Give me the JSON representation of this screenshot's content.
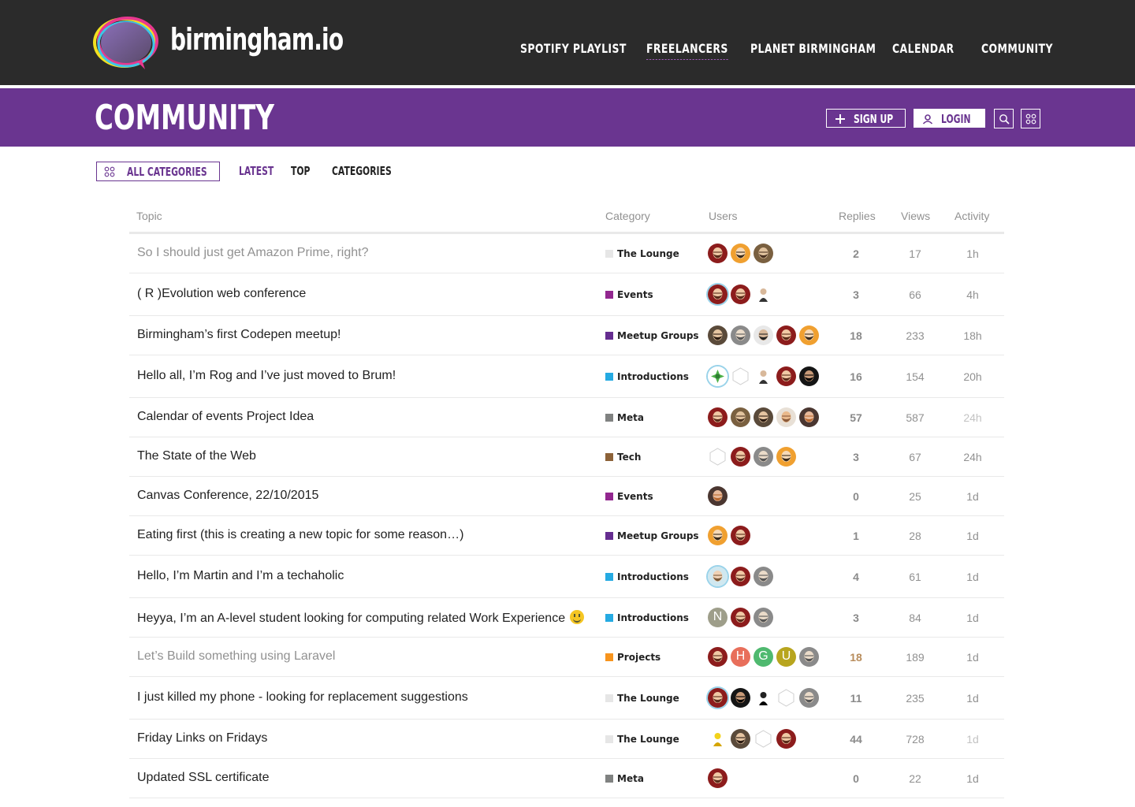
{
  "header": {
    "logo_text": "birmingham.io",
    "nav": [
      "SPOTIFY PLAYLIST",
      "FREELANCERS",
      "PLANET BIRMINGHAM",
      "CALENDAR",
      "COMMUNITY"
    ],
    "active_nav": "FREELANCERS"
  },
  "band": {
    "title": "COMMUNITY",
    "signup_label": "SIGN UP",
    "login_label": "LOGIN"
  },
  "subnav": {
    "filter_label": "ALL CATEGORIES",
    "items": [
      "LATEST",
      "TOP",
      "CATEGORIES"
    ],
    "active": "LATEST"
  },
  "table": {
    "headers": [
      "Topic",
      "Category",
      "Users",
      "Replies",
      "Views",
      "Activity"
    ],
    "rows": [
      {
        "title": "So I should just get Amazon Prime, right?",
        "visited": true,
        "category": "The Lounge",
        "cat_color": "#e6e6e6",
        "users": [
          "beard",
          "glasses",
          "brown"
        ],
        "replies": "2",
        "views": "17",
        "activity": "1h"
      },
      {
        "title": "( R )Evolution web conference",
        "visited": false,
        "category": "Events",
        "cat_color": "#92278f",
        "users": [
          "beard-ring",
          "beard",
          "tiny"
        ],
        "replies": "3",
        "views": "66",
        "activity": "4h"
      },
      {
        "title": "Birmingham’s first Codepen meetup!",
        "visited": false,
        "category": "Meetup Groups",
        "cat_color": "#652d90",
        "users": [
          "man",
          "grey",
          "dark",
          "beard",
          "glasses"
        ],
        "replies": "18",
        "views": "233",
        "activity": "18h"
      },
      {
        "title": "Hello all, I’m Rog and I’ve just moved to Brum!",
        "visited": false,
        "category": "Introductions",
        "cat_color": "#25aae2",
        "users": [
          "green-ring",
          "hex",
          "tiny",
          "beard",
          "black"
        ],
        "replies": "16",
        "views": "154",
        "activity": "20h"
      },
      {
        "title": "Calendar of events Project Idea",
        "visited": false,
        "category": "Meta",
        "cat_color": "#808281",
        "users": [
          "beard",
          "brown",
          "man",
          "skin",
          "woman"
        ],
        "replies": "57",
        "views": "587",
        "activity": "24h",
        "faded": true
      },
      {
        "title": "The State of the Web",
        "visited": false,
        "category": "Tech",
        "cat_color": "#8c6238",
        "users": [
          "hex",
          "beard",
          "grey",
          "glasses"
        ],
        "replies": "3",
        "views": "67",
        "activity": "24h"
      },
      {
        "title": "Canvas Conference, 22/10/2015",
        "visited": false,
        "category": "Events",
        "cat_color": "#92278f",
        "users": [
          "woman"
        ],
        "replies": "0",
        "views": "25",
        "activity": "1d"
      },
      {
        "title": "Eating first (this is creating a new topic for some reason…)",
        "visited": false,
        "category": "Meetup Groups",
        "cat_color": "#652d90",
        "users": [
          "glasses",
          "beard"
        ],
        "replies": "1",
        "views": "28",
        "activity": "1d"
      },
      {
        "title": "Hello, I’m Martin and I’m a techaholic",
        "visited": false,
        "category": "Introductions",
        "cat_color": "#25aae2",
        "users": [
          "face-ring",
          "beard",
          "grey"
        ],
        "replies": "4",
        "views": "61",
        "activity": "1d"
      },
      {
        "title": "Heyya, I’m an A-level student looking for computing related Work Experience",
        "emoji": true,
        "visited": false,
        "category": "Introductions",
        "cat_color": "#25aae2",
        "users": [
          "N",
          "beard",
          "grey"
        ],
        "replies": "3",
        "views": "84",
        "activity": "1d"
      },
      {
        "title": "Let’s Build something using Laravel",
        "visited": true,
        "category": "Projects",
        "cat_color": "#f7941d",
        "users": [
          "beard",
          "H",
          "G",
          "U",
          "grey"
        ],
        "replies": "18",
        "views": "189",
        "activity": "1d",
        "hot": true
      },
      {
        "title": "I just killed my phone - looking for replacement suggestions",
        "visited": false,
        "category": "The Lounge",
        "cat_color": "#e6e6e6",
        "users": [
          "beard-ring",
          "black",
          "ninja",
          "hex",
          "grey"
        ],
        "replies": "11",
        "views": "235",
        "activity": "1d"
      },
      {
        "title": "Friday Links on Fridays",
        "visited": false,
        "category": "The Lounge",
        "cat_color": "#e6e6e6",
        "users": [
          "yellow",
          "man",
          "hex",
          "beard"
        ],
        "replies": "44",
        "views": "728",
        "activity": "1d",
        "faded": true
      },
      {
        "title": "Updated SSL certificate",
        "visited": false,
        "category": "Meta",
        "cat_color": "#808281",
        "users": [
          "beard"
        ],
        "replies": "0",
        "views": "22",
        "activity": "1d"
      }
    ]
  },
  "letter_colors": {
    "N": "#9e9e8a",
    "H": "#e86f5b",
    "G": "#4fb96f",
    "U": "#b8a51e"
  }
}
